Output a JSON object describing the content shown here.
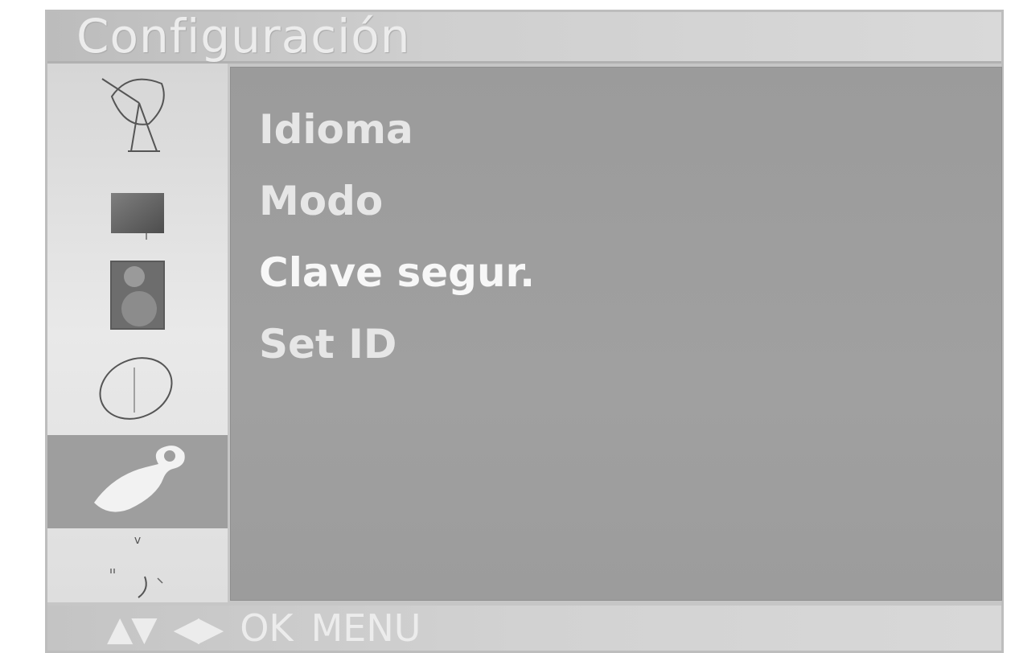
{
  "window": {
    "title": "Configuración"
  },
  "sidebar": {
    "items": [
      {
        "icon": "satellite-dish-icon",
        "selected": false
      },
      {
        "icon": "picture-icon",
        "selected": false
      },
      {
        "icon": "speaker-icon",
        "selected": false
      },
      {
        "icon": "clock-icon",
        "selected": false
      },
      {
        "icon": "wrench-icon",
        "selected": true
      },
      {
        "icon": "signal-icon",
        "selected": false
      }
    ],
    "scroll_marker": "v"
  },
  "menu": {
    "items": [
      {
        "label": "Idioma"
      },
      {
        "label": "Modo"
      },
      {
        "label": "Clave segur."
      },
      {
        "label": "Set ID"
      }
    ]
  },
  "footer": {
    "updown": "▲▼",
    "leftright": "◀▶",
    "ok": "OK",
    "menu": "MENU"
  },
  "colors": {
    "panel": "#9e9e9e",
    "sidebar": "#e2e2e2",
    "text": "#e6e6e6",
    "selected": "#9e9e9e"
  }
}
